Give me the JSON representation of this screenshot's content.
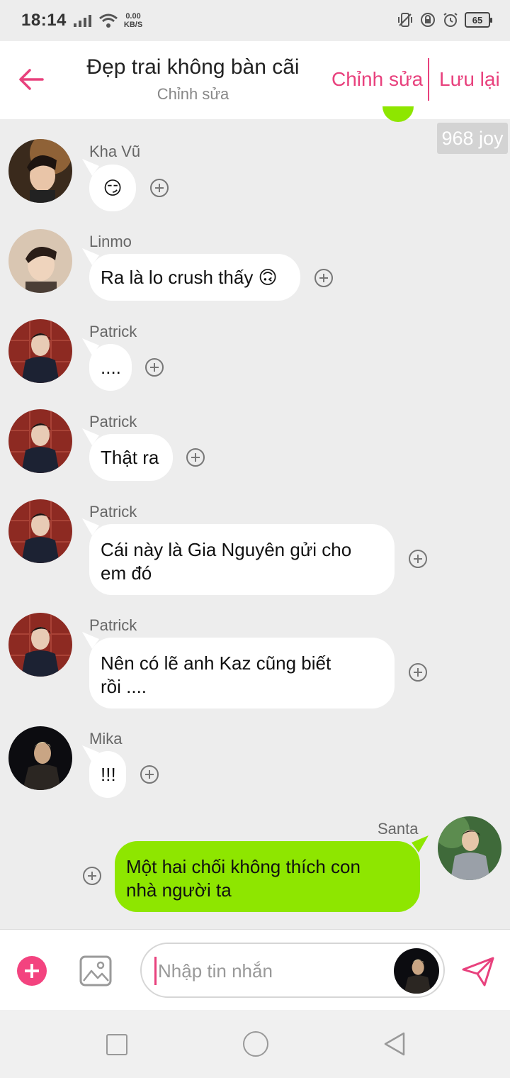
{
  "status_bar": {
    "time": "18:14",
    "net_speed_value": "0.00",
    "net_speed_unit": "KB/S",
    "battery": "65"
  },
  "header": {
    "title": "Đẹp trai không bàn cãi",
    "subtitle": "Chỉnh sửa",
    "edit_label": "Chỉnh sửa",
    "save_label": "Lưu lại"
  },
  "joy_badge": "968 joy",
  "messages": [
    {
      "sender": "Kha Vũ",
      "text": "😏"
    },
    {
      "sender": "Linmo",
      "text": "Ra là lo crush thấy 🙃"
    },
    {
      "sender": "Patrick",
      "text": "...."
    },
    {
      "sender": "Patrick",
      "text": "Thật ra"
    },
    {
      "sender": "Patrick",
      "text_line1": "Cái này là Gia Nguyên gửi cho",
      "text_line2": "em đó"
    },
    {
      "sender": "Patrick",
      "text_line1": "Nên có lẽ anh Kaz cũng biết",
      "text_line2": "rồi ...."
    },
    {
      "sender": "Mika",
      "text": "!!!"
    },
    {
      "sender": "Santa",
      "text_line1": "Một hai chối không thích con",
      "text_line2": "nhà người ta",
      "own": true
    }
  ],
  "input": {
    "placeholder": "Nhập tin nhắn"
  },
  "colors": {
    "accent": "#e8417d",
    "own_bubble": "#8ee600",
    "background": "#ededed"
  },
  "icons": [
    "back-arrow-icon",
    "add-reaction-icon",
    "plus-icon",
    "image-icon",
    "send-icon"
  ]
}
